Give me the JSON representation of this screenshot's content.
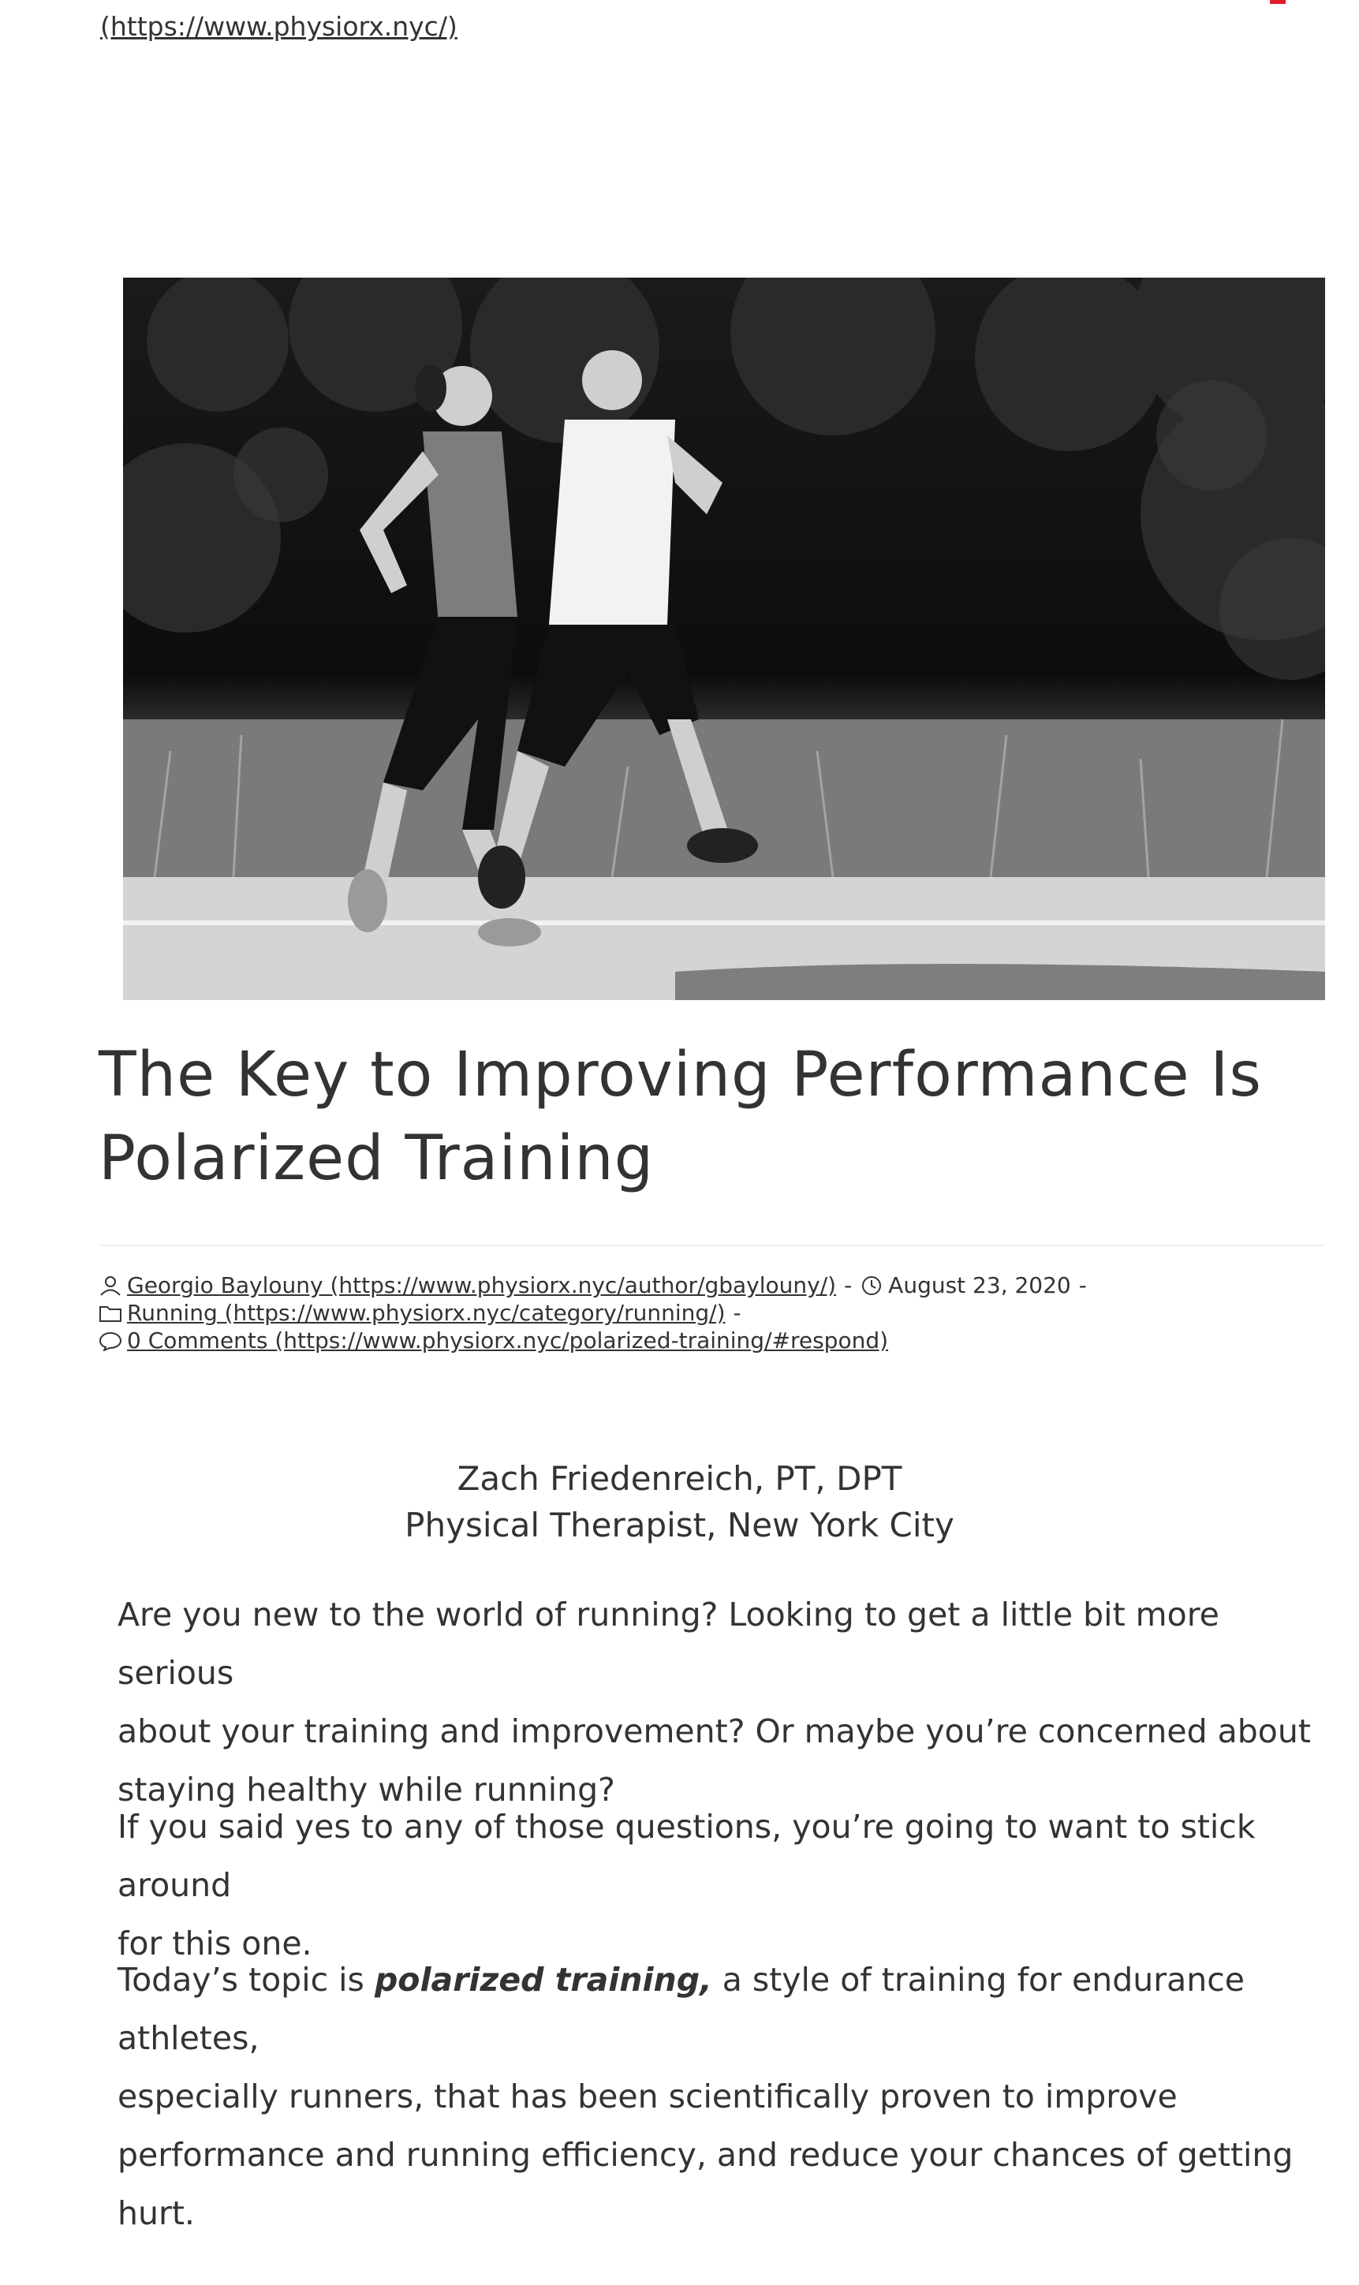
{
  "header": {
    "site_link": "(https://www.physiorx.nyc/)"
  },
  "hero": {
    "icon": "hero-photo-runners"
  },
  "article": {
    "title_line1": "The Key to Improving Performance Is",
    "title_line2": "Polarized Training",
    "meta": {
      "author": "Georgio Baylouny (https://www.physiorx.nyc/author/gbaylouny/)",
      "date": "August 23, 2020",
      "category": "Running (https://www.physiorx.nyc/category/running/)",
      "comments": "0 Comments (https://www.physiorx.nyc/polarized-training/#respond)",
      "sep": "-"
    },
    "byline_name": "Zach Friedenreich, PT, DPT",
    "byline_role": "Physical Therapist, New York City",
    "p1_l1": "Are you new to the world of running? Looking to get a little bit more serious",
    "p1_l2": "about your training and improvement? Or maybe you’re concerned about",
    "p1_l3": "staying healthy while running?",
    "p2_l1": "If you said yes to any of those questions, you’re going to want to stick around",
    "p2_l2": "for this one.",
    "p3_prefix": "Today’s topic is ",
    "p3_emph": "polarized training,",
    "p3_rest": " a style of training for endurance athletes,",
    "p3_l2": "especially runners, that has been scientifically proven to improve",
    "p3_l3": "performance and running efficiency, and reduce your chances of getting hurt."
  },
  "colors": {
    "accent": "#e21a2e",
    "text": "#333333"
  }
}
